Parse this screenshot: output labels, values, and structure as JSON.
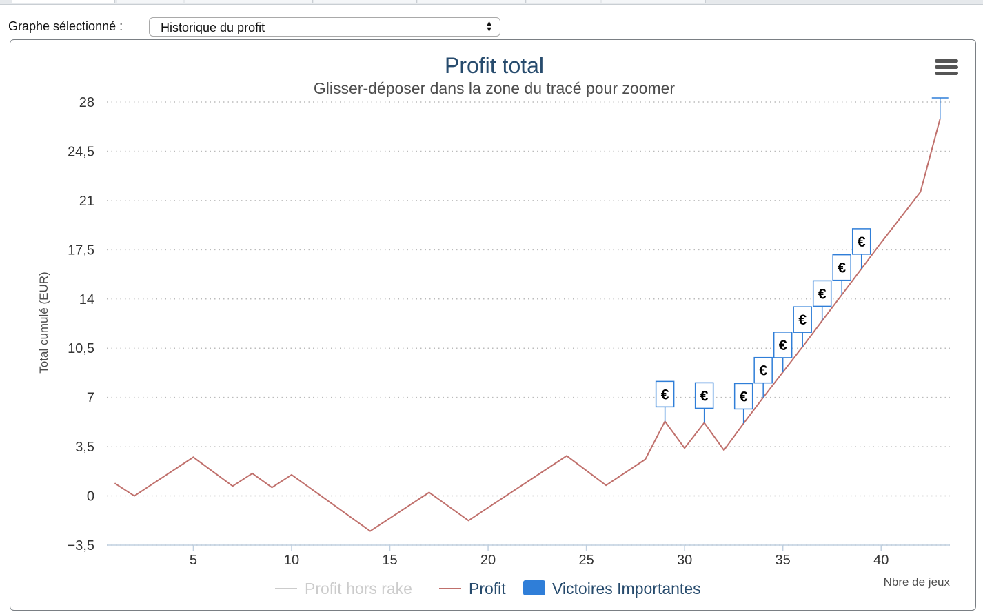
{
  "tabs": [
    "",
    "",
    "",
    "",
    "",
    "",
    ""
  ],
  "selector": {
    "label": "Graphe sélectionné :",
    "value": "Historique du profit",
    "arrows_icon": "up-down-arrows-icon"
  },
  "menu_icon": "hamburger-menu-icon",
  "colors": {
    "profit": "#c0706c",
    "profit_hors_rake": "#cccccc",
    "victoires": "#2f7ed8",
    "title": "#274b6d",
    "grid": "#bbbbbb"
  },
  "chart_data": {
    "type": "line",
    "title": "Profit total",
    "subtitle": "Glisser-déposer dans la zone du tracé pour zoomer",
    "xlabel": "Nbre de jeux",
    "ylabel": "Total cumulé (EUR)",
    "xlim": [
      0.6,
      43.5
    ],
    "ylim": [
      -3.5,
      28
    ],
    "x_ticks": [
      5,
      10,
      15,
      20,
      25,
      30,
      35,
      40
    ],
    "x_tick_labels": [
      "5",
      "10",
      "15",
      "20",
      "25",
      "30",
      "35",
      "40"
    ],
    "y_ticks": [
      -3.5,
      0,
      3.5,
      7,
      10.5,
      14,
      17.5,
      21,
      24.5,
      28
    ],
    "y_tick_labels": [
      "−3,5",
      "0",
      "3,5",
      "7",
      "10,5",
      "14",
      "17,5",
      "21",
      "24,5",
      "28"
    ],
    "grid": true,
    "legend_position": "bottom",
    "series": [
      {
        "name": "Profit hors rake",
        "type": "line",
        "visible": false,
        "values": []
      },
      {
        "name": "Profit",
        "type": "line",
        "x": [
          1,
          2,
          5,
          7,
          8,
          9,
          10,
          14,
          17,
          19,
          24,
          26,
          28,
          29,
          30,
          31,
          32,
          33,
          34,
          35,
          36,
          37,
          38,
          39,
          40,
          41,
          42,
          43
        ],
        "values": [
          0.9,
          0,
          2.75,
          0.7,
          1.6,
          0.6,
          1.5,
          -2.5,
          0.25,
          -1.75,
          2.85,
          0.75,
          2.6,
          5.3,
          3.4,
          5.2,
          3.25,
          5.15,
          7.0,
          8.8,
          10.6,
          12.45,
          14.3,
          16.15,
          18.0,
          19.8,
          21.6,
          26.8
        ]
      },
      {
        "name": "Victoires Importantes",
        "type": "flags",
        "symbol": "€",
        "x": [
          29,
          31,
          33,
          34,
          35,
          36,
          37,
          38,
          39,
          43
        ],
        "values": [
          5.3,
          5.2,
          5.15,
          7.0,
          8.8,
          10.6,
          12.45,
          14.3,
          16.15,
          26.8
        ]
      }
    ],
    "legend": [
      "Profit hors rake",
      "Profit",
      "Victoires Importantes"
    ]
  }
}
